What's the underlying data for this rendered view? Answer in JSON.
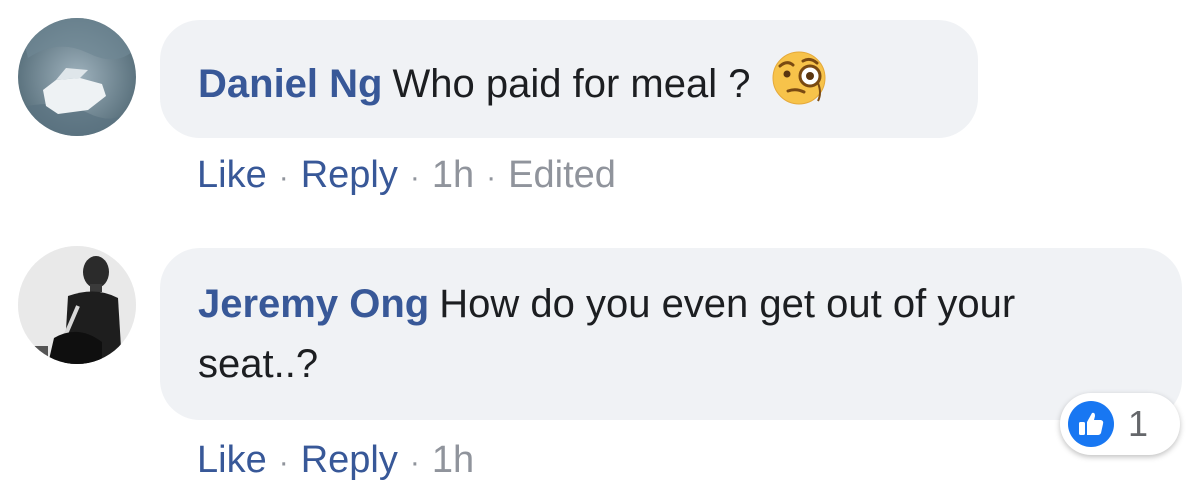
{
  "comments": [
    {
      "author": "Daniel Ng",
      "text": "Who paid for meal ?",
      "emoji": "face-with-monocle-icon",
      "actions": {
        "like": "Like",
        "reply": "Reply",
        "time": "1h",
        "edited": "Edited"
      }
    },
    {
      "author": "Jeremy Ong",
      "text": "How do you even get out of your seat..?",
      "actions": {
        "like": "Like",
        "reply": "Reply",
        "time": "1h"
      },
      "reactions": {
        "icon": "thumbs-up-icon",
        "count": "1"
      }
    }
  ],
  "colors": {
    "link": "#385898",
    "bubble": "#f0f2f5",
    "meta": "#90949c",
    "like_badge": "#1877f2"
  }
}
